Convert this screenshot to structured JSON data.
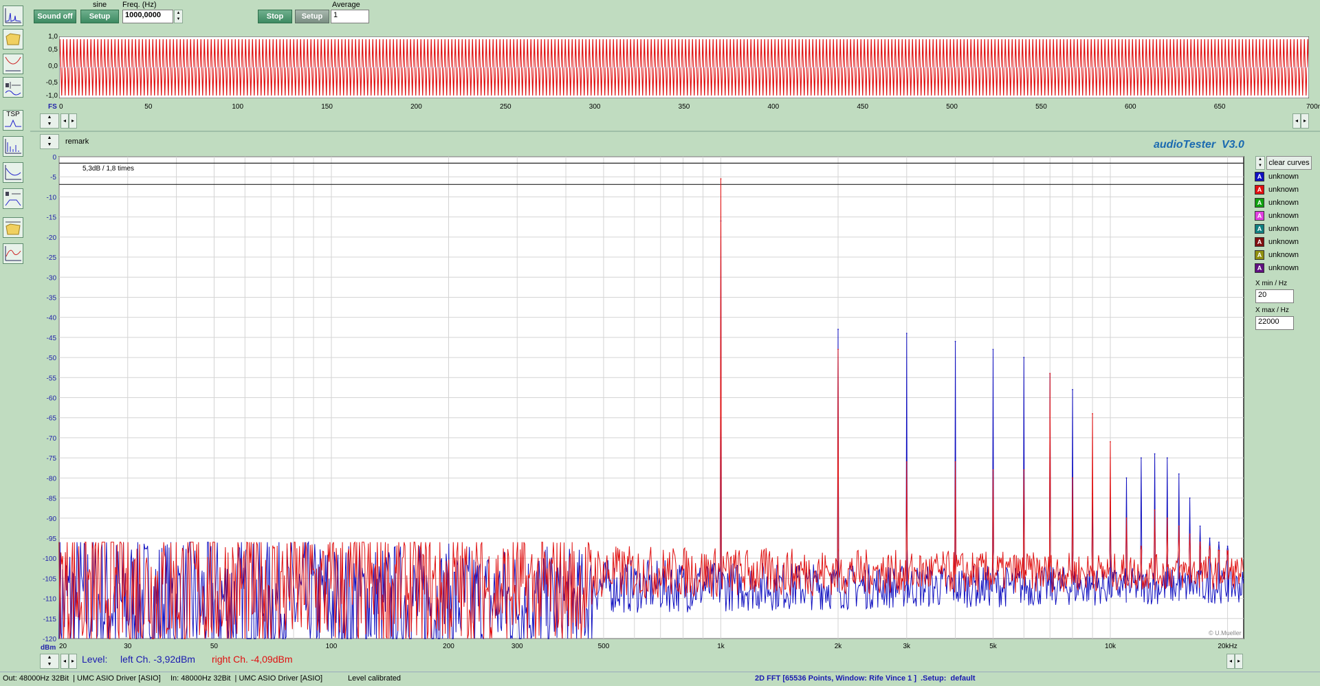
{
  "generator": {
    "sound_label": "Sound off",
    "waveform_label": "sine",
    "setup_label": "Setup",
    "freq_label": "Freq. (Hz)",
    "freq_value": "1000,0000"
  },
  "analyzer": {
    "stop_label": "Stop",
    "setup_label": "Setup",
    "average_label": "Average",
    "average_value": "1"
  },
  "toolbar": {
    "tsp_label": "TSP"
  },
  "scope": {
    "y_ticks": [
      "1,0",
      "0,5",
      "0,0",
      "-0,5",
      "-1,0"
    ],
    "fs_label": "FS",
    "x_ticks": [
      "0",
      "50",
      "100",
      "150",
      "200",
      "250",
      "300",
      "350",
      "400",
      "450",
      "500",
      "550",
      "600",
      "650",
      "700ms"
    ]
  },
  "fft": {
    "remark_label": "remark",
    "brand": "audioTester  V3.0",
    "annotation": "5,3dB / 1,8 times",
    "copyright": "© U.Mueller",
    "y_unit": "dBm",
    "clear_label": "clear curves",
    "xmin_label": "X min / Hz",
    "xmin_value": "20",
    "xmax_label": "X max / Hz",
    "xmax_value": "22000",
    "legend": [
      {
        "label": "unknown",
        "color": "#1010c0"
      },
      {
        "label": "unknown",
        "color": "#e01010"
      },
      {
        "label": "unknown",
        "color": "#10a010"
      },
      {
        "label": "unknown",
        "color": "#e040e0"
      },
      {
        "label": "unknown",
        "color": "#108080"
      },
      {
        "label": "unknown",
        "color": "#801010"
      },
      {
        "label": "unknown",
        "color": "#909010"
      },
      {
        "label": "unknown",
        "color": "#601080"
      }
    ],
    "level_label": "Level:",
    "left_level": "left Ch. -3,92dBm",
    "right_level": "right Ch. -4,09dBm"
  },
  "chart_data": {
    "type": "line",
    "x_scale": "log",
    "xlim": [
      20,
      22000
    ],
    "ylim": [
      -120,
      0
    ],
    "xlabel": "",
    "ylabel": "dBm",
    "x_ticks": [
      "20",
      "30",
      "50",
      "100",
      "200",
      "300",
      "500",
      "1k",
      "2k",
      "3k",
      "5k",
      "10k",
      "20kHz"
    ],
    "x_tick_values": [
      20,
      30,
      50,
      100,
      200,
      300,
      500,
      1000,
      2000,
      3000,
      5000,
      10000,
      20000
    ],
    "y_ticks": [
      0,
      -5,
      -10,
      -15,
      -20,
      -25,
      -30,
      -35,
      -40,
      -45,
      -50,
      -55,
      -60,
      -65,
      -70,
      -75,
      -80,
      -85,
      -90,
      -95,
      -100,
      -105,
      -110,
      -115,
      -120
    ],
    "grid": true,
    "noise_floor_db": -105,
    "series": [
      {
        "color": "#1010c0",
        "harmonics": [
          [
            1000,
            -16
          ],
          [
            2000,
            -43
          ],
          [
            3000,
            -44
          ],
          [
            4000,
            -46
          ],
          [
            5000,
            -48
          ],
          [
            6000,
            -50
          ],
          [
            7000,
            -54
          ],
          [
            8000,
            -58
          ],
          [
            9000,
            -84
          ],
          [
            10000,
            -86
          ],
          [
            11000,
            -80
          ],
          [
            12000,
            -75
          ],
          [
            13000,
            -74
          ],
          [
            14000,
            -75
          ],
          [
            15000,
            -79
          ],
          [
            16000,
            -85
          ],
          [
            17000,
            -92
          ],
          [
            18000,
            -95
          ],
          [
            19000,
            -96
          ],
          [
            20000,
            -97
          ]
        ]
      },
      {
        "color": "#e01010",
        "harmonics": [
          [
            1000,
            -5.5
          ],
          [
            2000,
            -48
          ],
          [
            3000,
            -76
          ],
          [
            4000,
            -76
          ],
          [
            5000,
            -78
          ],
          [
            6000,
            -78
          ],
          [
            7000,
            -54
          ],
          [
            8000,
            -80
          ],
          [
            9000,
            -64
          ],
          [
            10000,
            -71
          ],
          [
            11000,
            -90
          ],
          [
            12000,
            -97
          ],
          [
            13000,
            -88
          ],
          [
            14000,
            -90
          ],
          [
            15000,
            -92
          ],
          [
            16000,
            -94
          ],
          [
            17000,
            -96
          ],
          [
            18000,
            -97
          ],
          [
            19000,
            -98
          ],
          [
            20000,
            -99
          ]
        ]
      }
    ]
  },
  "statusbar": {
    "out": "Out: 48000Hz 32Bit  | UMC ASIO Driver [ASIO]",
    "in": "In: 48000Hz 32Bit  | UMC ASIO Driver [ASIO]",
    "calibration": "Level calibrated",
    "fft_info": "2D FFT [65536 Points, Window: Rife Vince 1 ]  .Setup:  default"
  }
}
